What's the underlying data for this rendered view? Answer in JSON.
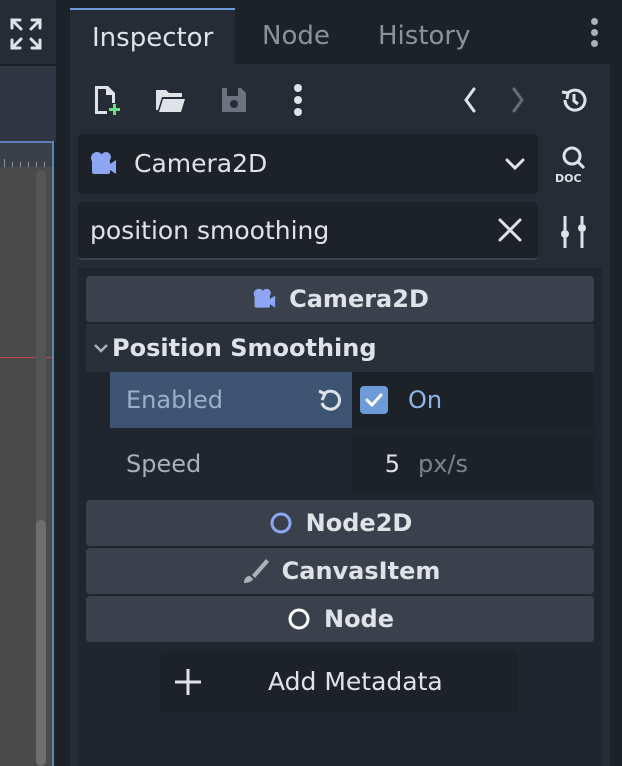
{
  "tabs": [
    {
      "label": "Inspector"
    },
    {
      "label": "Node"
    },
    {
      "label": "History"
    }
  ],
  "toolbar": {
    "icons": [
      "new-resource-icon",
      "open-folder-icon",
      "save-icon",
      "more-icon",
      "back-icon",
      "forward-icon",
      "history-icon"
    ]
  },
  "object_selector": {
    "label": "Camera2D",
    "icon": "camera2d-icon",
    "doc_icon": "doc-icon"
  },
  "search": {
    "value": "position smoothing",
    "clear_icon": "close-icon",
    "filter_icon": "property-filter-icon"
  },
  "sections": {
    "camera2d": "Camera2D",
    "node2d": "Node2D",
    "canvas_item": "CanvasItem",
    "node": "Node"
  },
  "group": {
    "label": "Position Smoothing"
  },
  "properties": {
    "enabled": {
      "name": "Enabled",
      "checked": true,
      "value_label": "On"
    },
    "speed": {
      "name": "Speed",
      "value": "5",
      "suffix": "px/s"
    }
  },
  "add_metadata": {
    "label": "Add Metadata"
  },
  "colors": {
    "accent": "#6f9ad8",
    "camera_icon": "#8da5f3",
    "background": "#262c36",
    "highlight_row": "#3e5473"
  }
}
